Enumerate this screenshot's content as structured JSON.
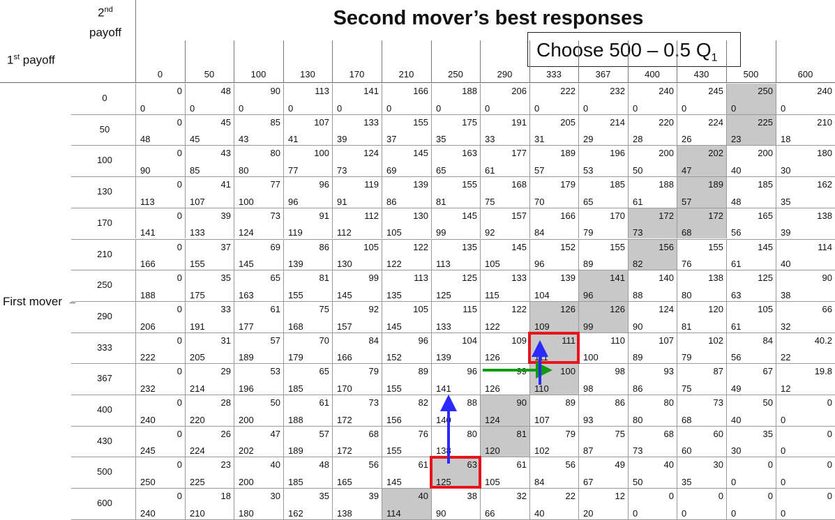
{
  "title": "Second mover’s best responses",
  "choose": {
    "text": "Choose 500 – 0.5 Q",
    "sub": "1"
  },
  "corner": {
    "second_ord": "2",
    "second_sup": "nd",
    "second_word": "payoff",
    "first_ord": "1",
    "first_sup": "st",
    "first_word": "payoff"
  },
  "row_label": "First mover",
  "columns": [
    "0",
    "50",
    "100",
    "130",
    "170",
    "210",
    "250",
    "290",
    "333",
    "367",
    "400",
    "430",
    "500",
    "600"
  ],
  "rows": [
    {
      "q": "0",
      "c": [
        [
          "0",
          "0"
        ],
        [
          "48",
          "0"
        ],
        [
          "90",
          "0"
        ],
        [
          "113",
          "0"
        ],
        [
          "141",
          "0"
        ],
        [
          "166",
          "0"
        ],
        [
          "188",
          "0"
        ],
        [
          "206",
          "0"
        ],
        [
          "222",
          "0"
        ],
        [
          "232",
          "0"
        ],
        [
          "240",
          "0"
        ],
        [
          "245",
          "0"
        ],
        [
          "250",
          "0"
        ],
        [
          "240",
          "0"
        ]
      ]
    },
    {
      "q": "50",
      "c": [
        [
          "0",
          "48"
        ],
        [
          "45",
          "45"
        ],
        [
          "85",
          "43"
        ],
        [
          "107",
          "41"
        ],
        [
          "133",
          "39"
        ],
        [
          "155",
          "37"
        ],
        [
          "175",
          "35"
        ],
        [
          "191",
          "33"
        ],
        [
          "205",
          "31"
        ],
        [
          "214",
          "29"
        ],
        [
          "220",
          "28"
        ],
        [
          "224",
          "26"
        ],
        [
          "225",
          "23"
        ],
        [
          "210",
          "18"
        ]
      ]
    },
    {
      "q": "100",
      "c": [
        [
          "0",
          "90"
        ],
        [
          "43",
          "85"
        ],
        [
          "80",
          "80"
        ],
        [
          "100",
          "77"
        ],
        [
          "124",
          "73"
        ],
        [
          "145",
          "69"
        ],
        [
          "163",
          "65"
        ],
        [
          "177",
          "61"
        ],
        [
          "189",
          "57"
        ],
        [
          "196",
          "53"
        ],
        [
          "200",
          "50"
        ],
        [
          "202",
          "47"
        ],
        [
          "200",
          "40"
        ],
        [
          "180",
          "30"
        ]
      ]
    },
    {
      "q": "130",
      "c": [
        [
          "0",
          "113"
        ],
        [
          "41",
          "107"
        ],
        [
          "77",
          "100"
        ],
        [
          "96",
          "96"
        ],
        [
          "119",
          "91"
        ],
        [
          "139",
          "86"
        ],
        [
          "155",
          "81"
        ],
        [
          "168",
          "75"
        ],
        [
          "179",
          "70"
        ],
        [
          "185",
          "65"
        ],
        [
          "188",
          "61"
        ],
        [
          "189",
          "57"
        ],
        [
          "185",
          "48"
        ],
        [
          "162",
          "35"
        ]
      ]
    },
    {
      "q": "170",
      "c": [
        [
          "0",
          "141"
        ],
        [
          "39",
          "133"
        ],
        [
          "73",
          "124"
        ],
        [
          "91",
          "119"
        ],
        [
          "112",
          "112"
        ],
        [
          "130",
          "105"
        ],
        [
          "145",
          "99"
        ],
        [
          "157",
          "92"
        ],
        [
          "166",
          "84"
        ],
        [
          "170",
          "79"
        ],
        [
          "172",
          "73"
        ],
        [
          "172",
          "68"
        ],
        [
          "165",
          "56"
        ],
        [
          "138",
          "39"
        ]
      ]
    },
    {
      "q": "210",
      "c": [
        [
          "0",
          "166"
        ],
        [
          "37",
          "155"
        ],
        [
          "69",
          "145"
        ],
        [
          "86",
          "139"
        ],
        [
          "105",
          "130"
        ],
        [
          "122",
          "122"
        ],
        [
          "135",
          "113"
        ],
        [
          "145",
          "105"
        ],
        [
          "152",
          "96"
        ],
        [
          "155",
          "89"
        ],
        [
          "156",
          "82"
        ],
        [
          "155",
          "76"
        ],
        [
          "145",
          "61"
        ],
        [
          "114",
          "40"
        ]
      ]
    },
    {
      "q": "250",
      "c": [
        [
          "0",
          "188"
        ],
        [
          "35",
          "175"
        ],
        [
          "65",
          "163"
        ],
        [
          "81",
          "155"
        ],
        [
          "99",
          "145"
        ],
        [
          "113",
          "135"
        ],
        [
          "125",
          "125"
        ],
        [
          "133",
          "115"
        ],
        [
          "139",
          "104"
        ],
        [
          "141",
          "96"
        ],
        [
          "140",
          "88"
        ],
        [
          "138",
          "80"
        ],
        [
          "125",
          "63"
        ],
        [
          "90",
          "38"
        ]
      ]
    },
    {
      "q": "290",
      "c": [
        [
          "0",
          "206"
        ],
        [
          "33",
          "191"
        ],
        [
          "61",
          "177"
        ],
        [
          "75",
          "168"
        ],
        [
          "92",
          "157"
        ],
        [
          "105",
          "145"
        ],
        [
          "115",
          "133"
        ],
        [
          "122",
          "122"
        ],
        [
          "126",
          "109"
        ],
        [
          "126",
          "99"
        ],
        [
          "124",
          "90"
        ],
        [
          "120",
          "81"
        ],
        [
          "105",
          "61"
        ],
        [
          "66",
          "32"
        ]
      ]
    },
    {
      "q": "333",
      "c": [
        [
          "0",
          "222"
        ],
        [
          "31",
          "205"
        ],
        [
          "57",
          "189"
        ],
        [
          "70",
          "179"
        ],
        [
          "84",
          "166"
        ],
        [
          "96",
          "152"
        ],
        [
          "104",
          "139"
        ],
        [
          "109",
          "126"
        ],
        [
          "111",
          "111"
        ],
        [
          "110",
          "100"
        ],
        [
          "107",
          "89"
        ],
        [
          "102",
          "79"
        ],
        [
          "84",
          "56"
        ],
        [
          "40.2",
          "22"
        ]
      ]
    },
    {
      "q": "367",
      "c": [
        [
          "0",
          "232"
        ],
        [
          "29",
          "214"
        ],
        [
          "53",
          "196"
        ],
        [
          "65",
          "185"
        ],
        [
          "79",
          "170"
        ],
        [
          "89",
          "155"
        ],
        [
          "96",
          "141"
        ],
        [
          "99",
          "126"
        ],
        [
          "100",
          "110"
        ],
        [
          "98",
          "98"
        ],
        [
          "93",
          "86"
        ],
        [
          "87",
          "75"
        ],
        [
          "67",
          "49"
        ],
        [
          "19.8",
          "12"
        ]
      ]
    },
    {
      "q": "400",
      "c": [
        [
          "0",
          "240"
        ],
        [
          "28",
          "220"
        ],
        [
          "50",
          "200"
        ],
        [
          "61",
          "188"
        ],
        [
          "73",
          "172"
        ],
        [
          "82",
          "156"
        ],
        [
          "88",
          "140"
        ],
        [
          "90",
          "124"
        ],
        [
          "89",
          "107"
        ],
        [
          "86",
          "93"
        ],
        [
          "80",
          "80"
        ],
        [
          "73",
          "68"
        ],
        [
          "50",
          "40"
        ],
        [
          "0",
          "0"
        ]
      ]
    },
    {
      "q": "430",
      "c": [
        [
          "0",
          "245"
        ],
        [
          "26",
          "224"
        ],
        [
          "47",
          "202"
        ],
        [
          "57",
          "189"
        ],
        [
          "68",
          "172"
        ],
        [
          "76",
          "155"
        ],
        [
          "80",
          "138"
        ],
        [
          "81",
          "120"
        ],
        [
          "79",
          "102"
        ],
        [
          "75",
          "87"
        ],
        [
          "68",
          "73"
        ],
        [
          "60",
          "60"
        ],
        [
          "35",
          "30"
        ],
        [
          "0",
          "0"
        ]
      ]
    },
    {
      "q": "500",
      "c": [
        [
          "0",
          "250"
        ],
        [
          "23",
          "225"
        ],
        [
          "40",
          "200"
        ],
        [
          "48",
          "185"
        ],
        [
          "56",
          "165"
        ],
        [
          "61",
          "145"
        ],
        [
          "63",
          "125"
        ],
        [
          "61",
          "105"
        ],
        [
          "56",
          "84"
        ],
        [
          "49",
          "67"
        ],
        [
          "40",
          "50"
        ],
        [
          "30",
          "35"
        ],
        [
          "0",
          "0"
        ],
        [
          "0",
          "0"
        ]
      ]
    },
    {
      "q": "600",
      "c": [
        [
          "0",
          "240"
        ],
        [
          "18",
          "210"
        ],
        [
          "30",
          "180"
        ],
        [
          "35",
          "162"
        ],
        [
          "39",
          "138"
        ],
        [
          "40",
          "114"
        ],
        [
          "38",
          "90"
        ],
        [
          "32",
          "66"
        ],
        [
          "22",
          "40"
        ],
        [
          "12",
          "20"
        ],
        [
          "0",
          "0"
        ],
        [
          "0",
          "0"
        ],
        [
          "0",
          "0"
        ],
        [
          "0",
          "0"
        ]
      ]
    }
  ],
  "shaded": [
    [
      0,
      12
    ],
    [
      1,
      12
    ],
    [
      2,
      11
    ],
    [
      3,
      11
    ],
    [
      4,
      10
    ],
    [
      4,
      11
    ],
    [
      5,
      10
    ],
    [
      6,
      9
    ],
    [
      7,
      8
    ],
    [
      7,
      9
    ],
    [
      8,
      8
    ],
    [
      9,
      8
    ],
    [
      10,
      7
    ],
    [
      11,
      7
    ],
    [
      12,
      6
    ],
    [
      13,
      5
    ]
  ],
  "highlighted": [
    [
      8,
      8
    ],
    [
      12,
      6
    ]
  ],
  "colors": {
    "shade": "#c8c8c8",
    "highlight": "#e8141c",
    "arrow_blue": "#2a2aff",
    "arrow_green": "#129a12"
  }
}
